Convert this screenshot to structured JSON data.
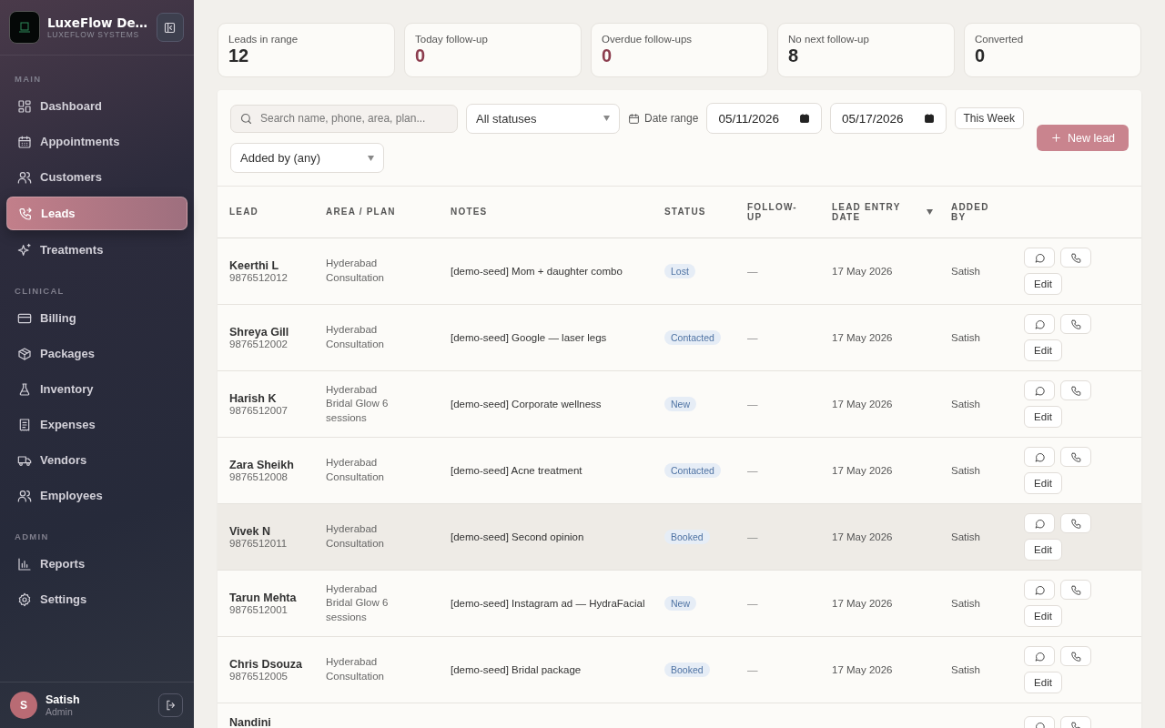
{
  "sidebar": {
    "brand": {
      "title": "LuxeFlow De…",
      "subtitle": "LUXEFLOW SYSTEMS"
    },
    "sections": [
      {
        "heading": "MAIN",
        "items": [
          {
            "label": "Dashboard",
            "selected": false
          },
          {
            "label": "Appointments",
            "selected": false
          },
          {
            "label": "Customers",
            "selected": false
          },
          {
            "label": "Leads",
            "selected": true
          },
          {
            "label": "Treatments",
            "selected": false
          }
        ]
      },
      {
        "heading": "CLINICAL",
        "items": [
          {
            "label": "Billing",
            "selected": false
          },
          {
            "label": "Packages",
            "selected": false
          },
          {
            "label": "Inventory",
            "selected": false
          },
          {
            "label": "Expenses",
            "selected": false
          },
          {
            "label": "Vendors",
            "selected": false
          },
          {
            "label": "Employees",
            "selected": false
          }
        ]
      },
      {
        "heading": "ADMIN",
        "items": [
          {
            "label": "Reports",
            "selected": false
          },
          {
            "label": "Settings",
            "selected": false
          }
        ]
      }
    ],
    "user": {
      "initial": "S",
      "name": "Satish",
      "role": "Admin"
    }
  },
  "stats": [
    {
      "label": "Leads in range",
      "value": "12",
      "accent": false
    },
    {
      "label": "Today follow-up",
      "value": "0",
      "accent": true
    },
    {
      "label": "Overdue follow-ups",
      "value": "0",
      "accent": true
    },
    {
      "label": "No next follow-up",
      "value": "8",
      "accent": false
    },
    {
      "label": "Converted",
      "value": "0",
      "accent": false
    }
  ],
  "filters": {
    "search": {
      "placeholder": "Search name, phone, area, plan..."
    },
    "status": "All statuses",
    "date_range_label": "Date range",
    "date_from": "05/11/2026",
    "date_to": "05/17/2026",
    "preset": "This Week",
    "added_by": "Added by (any)",
    "new_button": "New lead"
  },
  "table": {
    "columns": [
      {
        "label": "LEAD",
        "sorted": false
      },
      {
        "label": "AREA / PLAN",
        "sorted": false
      },
      {
        "label": "NOTES",
        "sorted": false
      },
      {
        "label": "STATUS",
        "sorted": false
      },
      {
        "label": "FOLLOW-UP",
        "sorted": false
      },
      {
        "label": "LEAD ENTRY DATE",
        "sorted": true
      },
      {
        "label": "ADDED BY",
        "sorted": false
      }
    ],
    "rows": [
      {
        "name": "Keerthi L",
        "phone": "9876512012",
        "area": "Hyderabad",
        "plan": "Consultation",
        "notes": "[demo-seed] Mom + daughter combo",
        "status": "Lost",
        "follow_up": "—",
        "date": "17 May 2026",
        "added_by": "Satish",
        "edit": "Edit",
        "hovered": false
      },
      {
        "name": "Shreya Gill",
        "phone": "9876512002",
        "area": "Hyderabad",
        "plan": "Consultation",
        "notes": "[demo-seed] Google — laser legs",
        "status": "Contacted",
        "follow_up": "—",
        "date": "17 May 2026",
        "added_by": "Satish",
        "edit": "Edit",
        "hovered": false
      },
      {
        "name": "Harish K",
        "phone": "9876512007",
        "area": "Hyderabad",
        "plan": "Bridal Glow 6 sessions",
        "notes": "[demo-seed] Corporate wellness",
        "status": "New",
        "follow_up": "—",
        "date": "17 May 2026",
        "added_by": "Satish",
        "edit": "Edit",
        "hovered": false
      },
      {
        "name": "Zara Sheikh",
        "phone": "9876512008",
        "area": "Hyderabad",
        "plan": "Consultation",
        "notes": "[demo-seed] Acne treatment",
        "status": "Contacted",
        "follow_up": "—",
        "date": "17 May 2026",
        "added_by": "Satish",
        "edit": "Edit",
        "hovered": false
      },
      {
        "name": "Vivek N",
        "phone": "9876512011",
        "area": "Hyderabad",
        "plan": "Consultation",
        "notes": "[demo-seed] Second opinion",
        "status": "Booked",
        "follow_up": "—",
        "date": "17 May 2026",
        "added_by": "Satish",
        "edit": "Edit",
        "hovered": true
      },
      {
        "name": "Tarun Mehta",
        "phone": "9876512001",
        "area": "Hyderabad",
        "plan": "Bridal Glow 6 sessions",
        "notes": "[demo-seed] Instagram ad — HydraFacial",
        "status": "New",
        "follow_up": "—",
        "date": "17 May 2026",
        "added_by": "Satish",
        "edit": "Edit",
        "hovered": false
      },
      {
        "name": "Chris Dsouza",
        "phone": "9876512005",
        "area": "Hyderabad",
        "plan": "Consultation",
        "notes": "[demo-seed] Bridal package",
        "status": "Booked",
        "follow_up": "—",
        "date": "17 May 2026",
        "added_by": "Satish",
        "edit": "Edit",
        "hovered": false
      },
      {
        "name": "Nandini",
        "hovered": false
      }
    ]
  }
}
